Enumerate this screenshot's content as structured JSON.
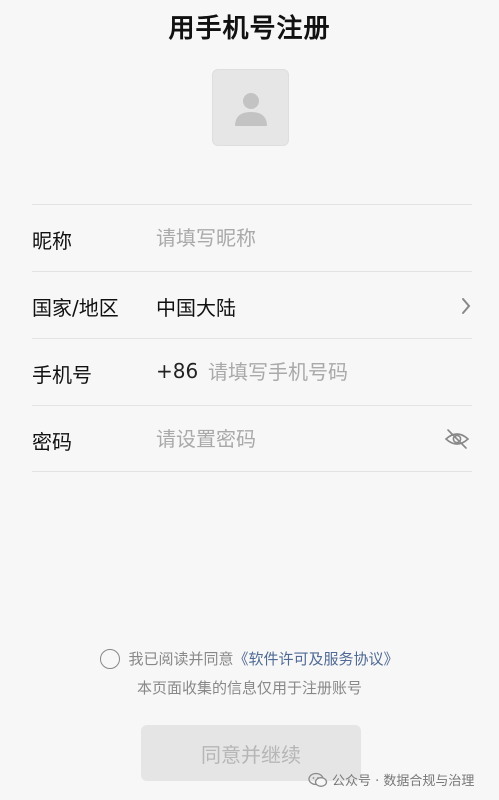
{
  "title": "用手机号注册",
  "form": {
    "nickname": {
      "label": "昵称",
      "placeholder": "请填写昵称"
    },
    "region": {
      "label": "国家/地区",
      "value": "中国大陆"
    },
    "phone": {
      "label": "手机号",
      "prefix": "+86",
      "placeholder": "请填写手机号码"
    },
    "password": {
      "label": "密码",
      "placeholder": "请设置密码"
    }
  },
  "agreement": {
    "text": "我已阅读并同意",
    "link": "《软件许可及服务协议》",
    "note": "本页面收集的信息仅用于注册账号"
  },
  "submit_label": "同意并继续",
  "watermark": "公众号 · 数据合规与治理",
  "icons": {
    "avatar": "person-placeholder-icon",
    "region_arrow": "chevron-right-icon",
    "password_toggle": "eye-off-icon",
    "watermark": "wechat-icon"
  },
  "colors": {
    "background": "#f7f7f7",
    "link": "#4f6a94",
    "button_bg": "#e5e5e5",
    "button_text": "#b6b6b6"
  }
}
